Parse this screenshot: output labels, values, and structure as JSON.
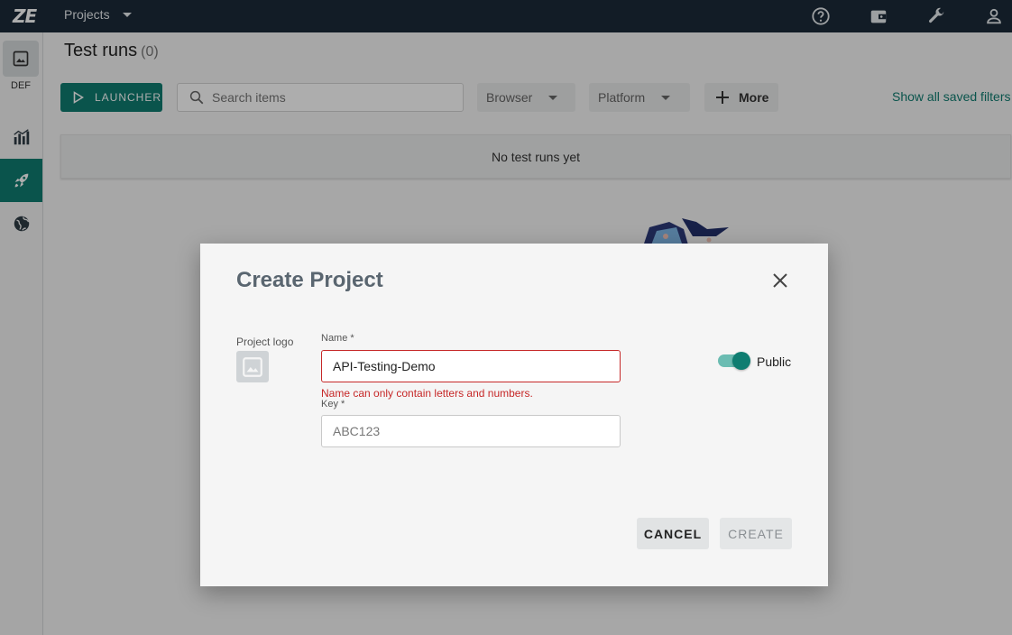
{
  "topbar": {
    "logo": "ZE",
    "project_switcher": "Projects",
    "icons": [
      "help-icon",
      "wallet-icon",
      "wrench-icon",
      "account-icon"
    ]
  },
  "sidebar": {
    "project_code": "DEF",
    "items": [
      "dashboards-icon",
      "test-runs-icon",
      "integrations-icon"
    ]
  },
  "main": {
    "title": "Test runs",
    "count": "(0)",
    "launcher_label": "LAUNCHER",
    "search_placeholder": "Search items",
    "filters": [
      "Browser",
      "Platform"
    ],
    "more_label": "More",
    "saved_filters_link": "Show all saved filters",
    "empty_message": "No test runs yet"
  },
  "modal": {
    "title": "Create Project",
    "logo_label": "Project logo",
    "name_label": "Name *",
    "name_value": "API-Testing-Demo",
    "name_error": "Name can only contain letters and numbers.",
    "key_label": "Key *",
    "key_placeholder": "ABC123",
    "public_label": "Public",
    "public_enabled": true,
    "cancel_label": "CANCEL",
    "create_label": "CREATE"
  },
  "colors": {
    "topbar": "#1b2a38",
    "accent": "#0f7d71",
    "error": "#c62828"
  }
}
